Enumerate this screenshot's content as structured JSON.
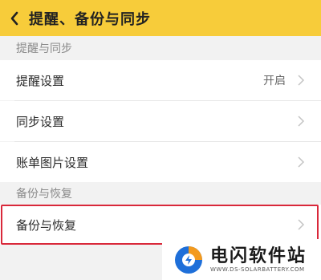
{
  "header": {
    "title": "提醒、备份与同步"
  },
  "sections": [
    {
      "title": "提醒与同步",
      "items": [
        {
          "label": "提醒设置",
          "value": "开启"
        },
        {
          "label": "同步设置",
          "value": ""
        },
        {
          "label": "账单图片设置",
          "value": ""
        }
      ]
    },
    {
      "title": "备份与恢复",
      "items": [
        {
          "label": "备份与恢复",
          "value": ""
        }
      ]
    }
  ],
  "watermark": {
    "name": "电闪软件站",
    "url": "WWW.DS-SOLARBATTERY.COM"
  },
  "colors": {
    "header_bg": "#f7cc3a",
    "highlight_border": "#d9283a",
    "logo_blue": "#1e6fd9",
    "logo_orange": "#f39a1e"
  }
}
